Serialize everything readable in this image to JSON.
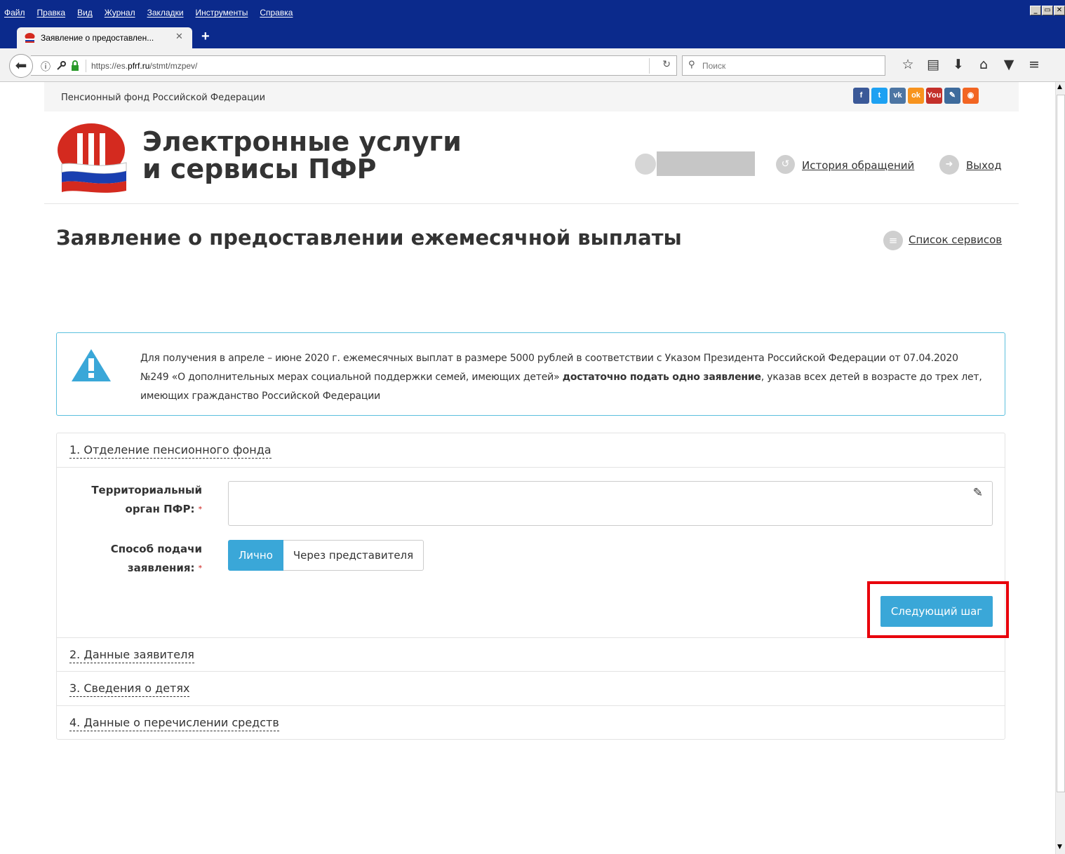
{
  "browser": {
    "menu": [
      "Файл",
      "Правка",
      "Вид",
      "Журнал",
      "Закладки",
      "Инструменты",
      "Справка"
    ],
    "window_controls": [
      "_",
      "▭",
      "✕"
    ],
    "tab_title": "Заявление о предоставлен...",
    "tab_close": "✕",
    "new_tab": "+",
    "url_prefix": "https://es.",
    "url_domain": "pfrf.ru",
    "url_path": "/stmt/mzpev/",
    "search_placeholder": "Поиск"
  },
  "site": {
    "org_name": "Пенсионный фонд Российской Федерации",
    "brand_line1": "Электронные услуги",
    "brand_line2": "и сервисы ПФР",
    "history_link": "История обращений",
    "exit_link": "Выход",
    "services_link": "Список сервисов",
    "social": [
      {
        "icon": "facebook-icon",
        "glyph": "f",
        "color": "#3b5998"
      },
      {
        "icon": "twitter-icon",
        "glyph": "t",
        "color": "#1da1f2"
      },
      {
        "icon": "vk-icon",
        "glyph": "vk",
        "color": "#4c75a3"
      },
      {
        "icon": "odnoklassniki-icon",
        "glyph": "ok",
        "color": "#f7931e"
      },
      {
        "icon": "youtube-icon",
        "glyph": "You",
        "color": "#c4302b"
      },
      {
        "icon": "livejournal-icon",
        "glyph": "✎",
        "color": "#3e6b9c"
      },
      {
        "icon": "rss-icon",
        "glyph": "◉",
        "color": "#f26522"
      }
    ]
  },
  "page": {
    "title": "Заявление о предоставлении ежемесячной выплаты",
    "notice_part1": "Для получения в апреле – июне 2020 г. ежемесячных выплат в размере 5000 рублей в соответствии с Указом Президента Российской Федерации от 07.04.2020 №249 «О дополнительных мерах социальной поддержки семей, имеющих детей»",
    "notice_bold": "достаточно подать одно заявление",
    "notice_part2": ", указав всех детей в возрасте до трех лет, имеющих гражданство Российской Федерации"
  },
  "wizard": {
    "steps": [
      "1. Отделение пенсионного фонда",
      "2. Данные заявителя",
      "3. Сведения о детях",
      "4. Данные о перечислении средств"
    ],
    "territorial_label_1": "Территориальный",
    "territorial_label_2": "орган ПФР:",
    "territorial_value": "",
    "method_label_1": "Способ подачи",
    "method_label_2": "заявления:",
    "required_mark": "*",
    "method_options": [
      "Лично",
      "Через представителя"
    ],
    "method_selected": "Лично",
    "next_button": "Следующий шаг"
  },
  "colors": {
    "accent": "#3aa7d8",
    "highlight": "#e8000b",
    "notice_border": "#5bc0de"
  }
}
